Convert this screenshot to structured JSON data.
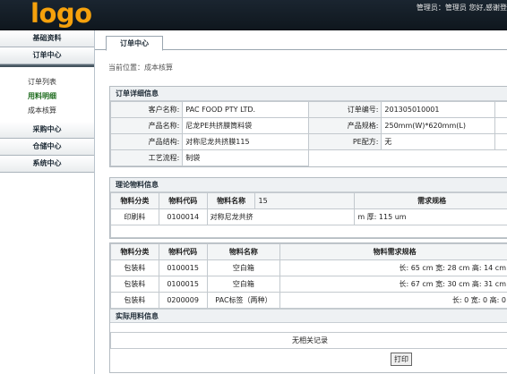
{
  "header": {
    "logo": "logo",
    "user_text": "管理员：管理员  您好,感谢登"
  },
  "sidebar": {
    "menus": [
      {
        "label": "基础资料"
      },
      {
        "label": "订单中心"
      }
    ],
    "order_submenu": [
      {
        "label": "订单列表",
        "active": false
      },
      {
        "label": "用料明细",
        "active": true
      },
      {
        "label": "成本核算",
        "active": false
      }
    ],
    "menus_after": [
      {
        "label": "采购中心"
      },
      {
        "label": "仓储中心"
      },
      {
        "label": "系统中心"
      }
    ]
  },
  "main": {
    "tab_label": "订单中心",
    "breadcrumb": "当前位置：成本核算",
    "order_detail": {
      "title": "订单详细信息",
      "rows": [
        {
          "l1": "客户名称:",
          "v1": "PAC FOOD PTY LTD.",
          "l2": "订单编号:",
          "v2": "201305010001"
        },
        {
          "l1": "产品名称:",
          "v1": "尼龙PE共挤膜筒料袋",
          "l2": "产品规格:",
          "v2": "250mm(W)*620mm(L)"
        },
        {
          "l1": "产品结构:",
          "v1": "对称尼龙共挤膜115",
          "l2": "PE配方:",
          "v2": "无"
        },
        {
          "l1": "工艺流程:",
          "v1": "制袋",
          "l2": "",
          "v2": ""
        }
      ]
    },
    "theory": {
      "title": "理论物料信息",
      "headers": [
        "物料分类",
        "物料代码",
        "物料名称",
        "15",
        "需求规格"
      ],
      "rows": [
        {
          "cat": "印刷料",
          "code": "0100014",
          "name": "对称尼龙共挤",
          "spec": "m 厚: 115 um"
        }
      ]
    },
    "packaging": {
      "headers": [
        "物料分类",
        "物料代码",
        "物料名称",
        "物料需求规格"
      ],
      "rows": [
        {
          "cat": "包装料",
          "code": "0100015",
          "name": "空白箱",
          "spec": "长: 65 cm 宽: 28 cm 高: 14 cm"
        },
        {
          "cat": "包装料",
          "code": "0100015",
          "name": "空白箱",
          "spec": "长: 67 cm 宽: 30 cm 高: 31 cm"
        },
        {
          "cat": "包装料",
          "code": "0200009",
          "name": "PAC标签（两种）",
          "spec": "长: 0 宽: 0 高: 0"
        }
      ]
    },
    "actual": {
      "title": "实际用料信息",
      "empty_text": "无相关记录"
    },
    "print_label": "打印"
  }
}
